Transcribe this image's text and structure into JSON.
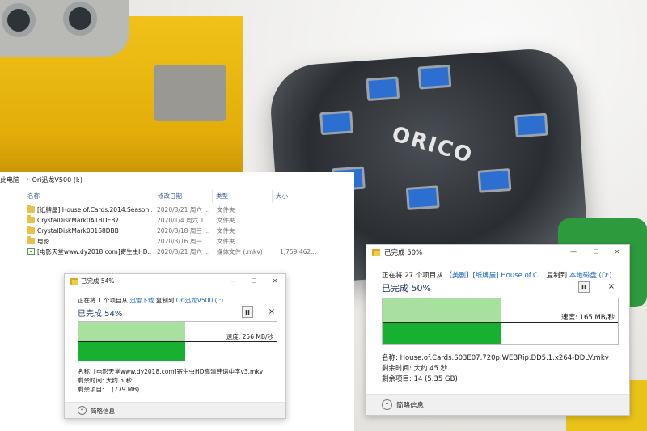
{
  "explorer": {
    "breadcrumb_root": "此电脑",
    "breadcrumb_drive": "Ori迅龙V500 (I:)",
    "columns": {
      "name": "名称",
      "modified": "修改日期",
      "type": "类型",
      "size": "大小"
    },
    "files": [
      {
        "icon": "folder-icon",
        "name": "[纸牌屋].House.of.Cards.2014.Season....",
        "modified": "2020/3/21 周六 ...",
        "type": "文件夹",
        "size": ""
      },
      {
        "icon": "folder-icon",
        "name": "CrystalDiskMark0A1BDEB7",
        "modified": "2020/1/4 周六 1...",
        "type": "文件夹",
        "size": ""
      },
      {
        "icon": "folder-icon",
        "name": "CrystalDiskMark00168DBB",
        "modified": "2020/3/18 周三 ...",
        "type": "文件夹",
        "size": ""
      },
      {
        "icon": "folder-icon",
        "name": "电影",
        "modified": "2020/3/16 周一 ...",
        "type": "文件夹",
        "size": ""
      },
      {
        "icon": "video-file-icon",
        "name": "[电影天堂www.dy2018.com]寄生虫HD...",
        "modified": "2020/3/21 周六 ...",
        "type": "媒体文件 (.mkv)",
        "size": "1,759,462..."
      }
    ]
  },
  "dialog_left": {
    "title": "已完成 54%",
    "status_prefix": "正在将 1 个项目从",
    "source": "迅雷下载",
    "copy_to": "复制到",
    "dest": "Ori迅龙V500 (I:)",
    "progress_text": "已完成 54%",
    "progress": 0.54,
    "speed": "速度: 256 MB/秒",
    "name_line": "名称: [电影天堂www.dy2018.com]寄生虫HD高清韩语中字v3.mkv",
    "time_line": "剩余时间: 大约 5 秒",
    "items_line": "剩余项目: 1 (779 MB)",
    "details": "简略信息",
    "colors": {
      "graph_top": "#a8e0a0",
      "graph_fill": "#18b030"
    }
  },
  "dialog_right": {
    "title": "已完成 50%",
    "status_prefix": "正在将 27 个项目从",
    "source": "【美剧】[纸牌屋].House.of.C...",
    "copy_to": "复制到",
    "dest": "本地磁盘 (D:)",
    "progress_text": "已完成 50%",
    "progress": 0.5,
    "speed": "速度: 165 MB/秒",
    "name_line": "名称: House.of.Cards.S03E07.720p.WEBRip.DD5.1.x264-DDLV.mkv",
    "time_line": "剩余时间: 大约 45 秒",
    "items_line": "剩余项目: 14 (5.35 GB)",
    "details": "简略信息",
    "colors": {
      "graph_top": "#a8e0a0",
      "graph_fill": "#18b030"
    }
  },
  "window_controls": {
    "minimize": "—",
    "maximize": "☐",
    "close": "✕",
    "pause": "II",
    "cancel": "×",
    "chevron": "⌃"
  }
}
